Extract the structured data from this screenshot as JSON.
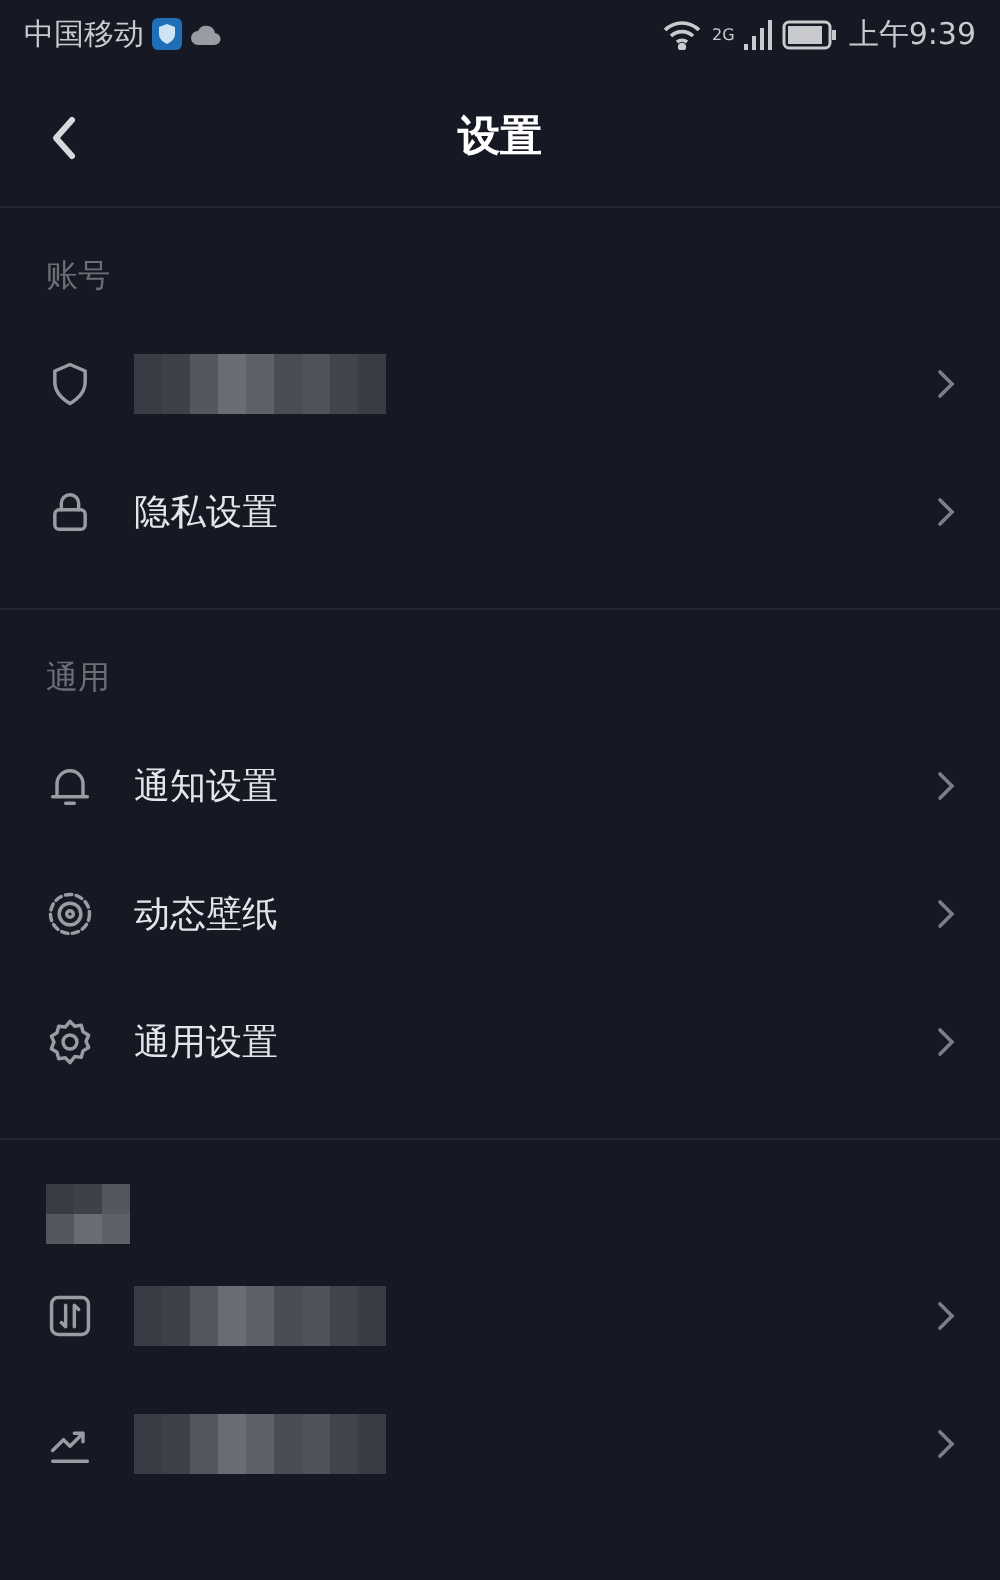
{
  "status_bar": {
    "carrier": "中国移动",
    "network": "2G",
    "time": "上午9:39"
  },
  "header": {
    "title": "设置"
  },
  "sections": [
    {
      "kind": "text",
      "title": "账号",
      "items": [
        {
          "kind": "redacted"
        },
        {
          "kind": "text",
          "label": "隐私设置"
        }
      ]
    },
    {
      "kind": "text",
      "title": "通用",
      "items": [
        {
          "kind": "text",
          "label": "通知设置"
        },
        {
          "kind": "text",
          "label": "动态壁纸"
        },
        {
          "kind": "text",
          "label": "通用设置"
        }
      ]
    },
    {
      "kind": "redacted",
      "items": [
        {
          "kind": "redacted"
        },
        {
          "kind": "redacted"
        }
      ]
    }
  ]
}
